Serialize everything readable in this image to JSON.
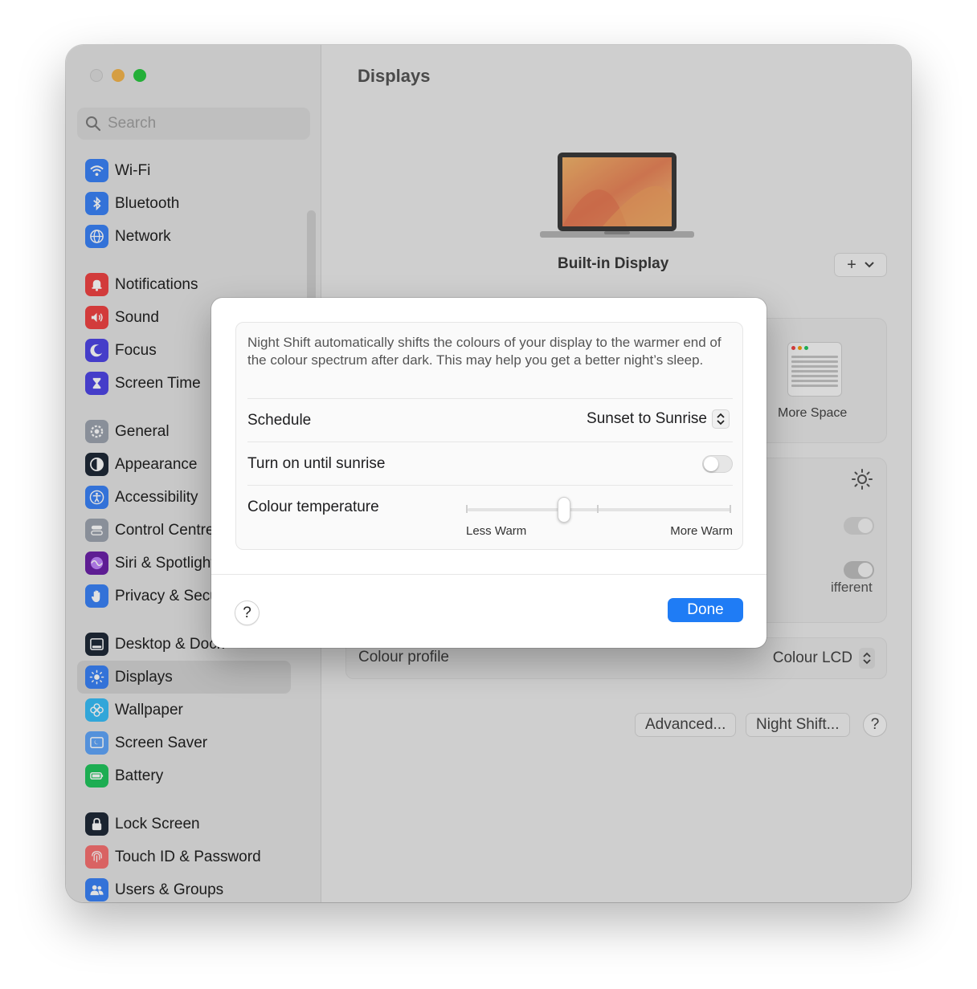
{
  "window": {
    "title": "Displays"
  },
  "search": {
    "placeholder": "Search"
  },
  "sidebar": {
    "items": [
      {
        "label": "Wi-Fi",
        "icon": "wifi-icon",
        "color": "#3b82f6",
        "group": 1
      },
      {
        "label": "Bluetooth",
        "icon": "bluetooth-icon",
        "color": "#3b82f6",
        "group": 1
      },
      {
        "label": "Network",
        "icon": "globe-icon",
        "color": "#3b82f6",
        "group": 1
      },
      {
        "label": "Notifications",
        "icon": "bell-icon",
        "color": "#ef4444",
        "group": 2
      },
      {
        "label": "Sound",
        "icon": "speaker-icon",
        "color": "#ef4444",
        "group": 2
      },
      {
        "label": "Focus",
        "icon": "moon-icon",
        "color": "#4f46e5",
        "group": 2
      },
      {
        "label": "Screen Time",
        "icon": "hourglass-icon",
        "color": "#4f46e5",
        "group": 2
      },
      {
        "label": "General",
        "icon": "gear-icon",
        "color": "#9ca3af",
        "group": 3
      },
      {
        "label": "Appearance",
        "icon": "appearance-icon",
        "color": "#1f2937",
        "group": 3
      },
      {
        "label": "Accessibility",
        "icon": "accessibility-icon",
        "color": "#3b82f6",
        "group": 3
      },
      {
        "label": "Control Centre",
        "icon": "control-centre-icon",
        "color": "#9ca3af",
        "group": 3
      },
      {
        "label": "Siri & Spotlight",
        "icon": "siri-icon",
        "color": "#6b21a8",
        "group": 3
      },
      {
        "label": "Privacy & Security",
        "icon": "hand-icon",
        "color": "#3b82f6",
        "group": 3
      },
      {
        "label": "Desktop & Dock",
        "icon": "dock-icon",
        "color": "#1f2937",
        "group": 4
      },
      {
        "label": "Displays",
        "icon": "sun-icon",
        "color": "#3b82f6",
        "group": 4,
        "selected": true
      },
      {
        "label": "Wallpaper",
        "icon": "flower-icon",
        "color": "#38bdf8",
        "group": 4
      },
      {
        "label": "Screen Saver",
        "icon": "screen-saver-icon",
        "color": "#60a5fa",
        "group": 4
      },
      {
        "label": "Battery",
        "icon": "battery-icon",
        "color": "#22c55e",
        "group": 4
      },
      {
        "label": "Lock Screen",
        "icon": "lock-icon",
        "color": "#1f2937",
        "group": 5
      },
      {
        "label": "Touch ID & Password",
        "icon": "fingerprint-icon",
        "color": "#f87171",
        "group": 5
      },
      {
        "label": "Users & Groups",
        "icon": "users-icon",
        "color": "#3b82f6",
        "group": 5
      }
    ]
  },
  "main": {
    "display_name": "Built-in Display",
    "more_space_label": "More Space",
    "different_fragment": "ifferent",
    "colour_profile_label": "Colour profile",
    "colour_profile_value": "Colour LCD",
    "advanced_label": "Advanced...",
    "night_shift_label": "Night Shift...",
    "help_label": "?"
  },
  "dialog": {
    "description": "Night Shift automatically shifts the colours of your display to the warmer end of the colour spectrum after dark. This may help you get a better night’s sleep.",
    "schedule_label": "Schedule",
    "schedule_value": "Sunset to Sunrise",
    "turn_on_label": "Turn on until sunrise",
    "turn_on_state": false,
    "temperature_label": "Colour temperature",
    "temperature_min_label": "Less Warm",
    "temperature_max_label": "More Warm",
    "temperature_value": 0.36,
    "help_label": "?",
    "done_label": "Done",
    "accent_color": "#1f7cf5"
  }
}
